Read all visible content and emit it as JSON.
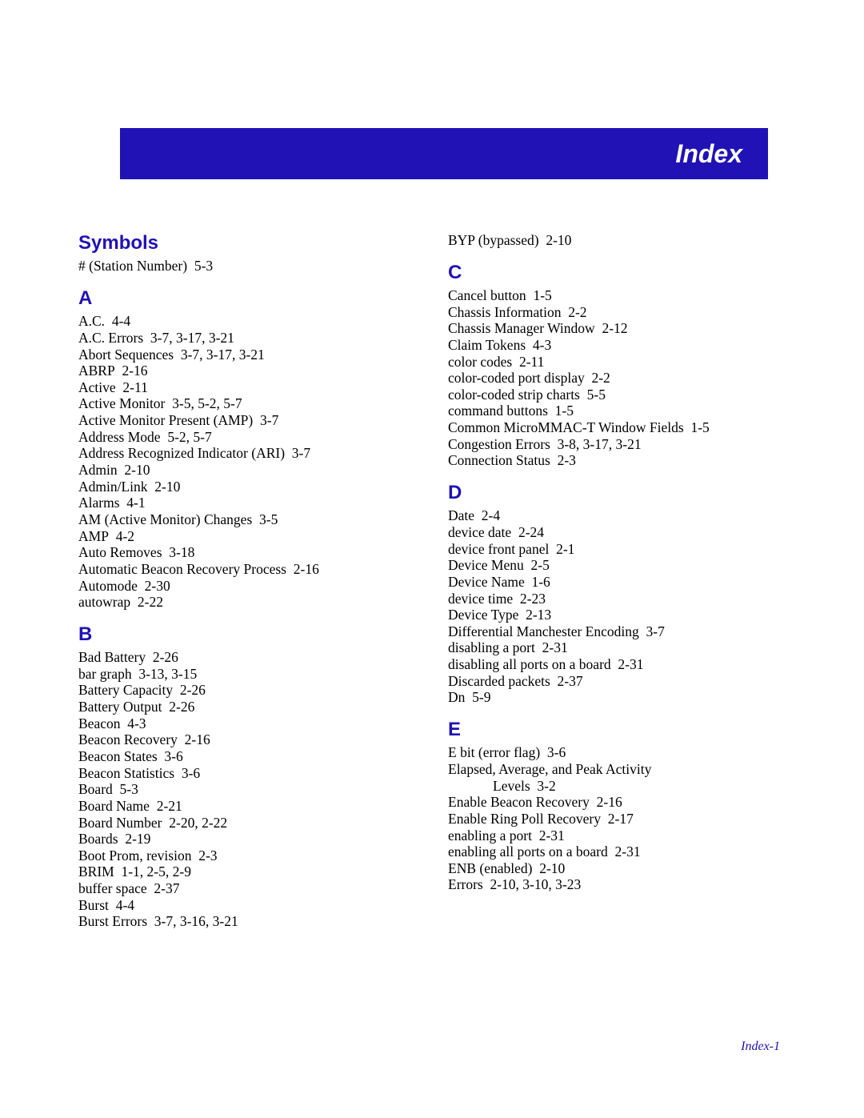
{
  "title": "Index",
  "footer": "Index-1",
  "sections": [
    {
      "col": 0,
      "title": "Symbols",
      "first": true,
      "entries": [
        {
          "t": "# (Station Number)",
          "r": "5-3"
        }
      ]
    },
    {
      "col": 0,
      "title": "A",
      "entries": [
        {
          "t": "A.C.",
          "r": "4-4"
        },
        {
          "t": "A.C. Errors",
          "r": "3-7, 3-17, 3-21"
        },
        {
          "t": "Abort Sequences",
          "r": "3-7, 3-17, 3-21"
        },
        {
          "t": "ABRP",
          "r": "2-16"
        },
        {
          "t": "Active",
          "r": "2-11"
        },
        {
          "t": "Active Monitor",
          "r": "3-5, 5-2, 5-7"
        },
        {
          "t": "Active Monitor Present (AMP)",
          "r": "3-7"
        },
        {
          "t": "Address Mode",
          "r": "5-2, 5-7"
        },
        {
          "t": "Address Recognized Indicator (ARI)",
          "r": "3-7"
        },
        {
          "t": "Admin",
          "r": "2-10"
        },
        {
          "t": "Admin/Link",
          "r": "2-10"
        },
        {
          "t": "Alarms",
          "r": "4-1"
        },
        {
          "t": "AM (Active Monitor) Changes",
          "r": "3-5"
        },
        {
          "t": "AMP",
          "r": "4-2"
        },
        {
          "t": "Auto Removes",
          "r": "3-18"
        },
        {
          "t": "Automatic Beacon Recovery Process",
          "r": "2-16"
        },
        {
          "t": "Automode",
          "r": "2-30"
        },
        {
          "t": "autowrap",
          "r": "2-22"
        }
      ]
    },
    {
      "col": 0,
      "title": "B",
      "entries": [
        {
          "t": "Bad Battery",
          "r": "2-26"
        },
        {
          "t": "bar graph",
          "r": "3-13, 3-15"
        },
        {
          "t": "Battery Capacity",
          "r": "2-26"
        },
        {
          "t": "Battery Output",
          "r": "2-26"
        },
        {
          "t": "Beacon",
          "r": "4-3"
        },
        {
          "t": "Beacon Recovery",
          "r": "2-16"
        },
        {
          "t": "Beacon States",
          "r": "3-6"
        },
        {
          "t": "Beacon Statistics",
          "r": "3-6"
        },
        {
          "t": "Board",
          "r": "5-3"
        },
        {
          "t": "Board Name",
          "r": "2-21"
        },
        {
          "t": "Board Number",
          "r": "2-20, 2-22"
        },
        {
          "t": "Boards",
          "r": "2-19"
        },
        {
          "t": "Boot Prom, revision",
          "r": "2-3"
        },
        {
          "t": "BRIM",
          "r": "1-1, 2-5, 2-9"
        },
        {
          "t": "buffer space",
          "r": "2-37"
        },
        {
          "t": "Burst",
          "r": "4-4"
        },
        {
          "t": "Burst Errors",
          "r": "3-7, 3-16, 3-21"
        }
      ]
    },
    {
      "col": 1,
      "title": "",
      "first": true,
      "entries": [
        {
          "t": "BYP (bypassed)",
          "r": "2-10"
        }
      ]
    },
    {
      "col": 1,
      "title": "C",
      "entries": [
        {
          "t": "Cancel button",
          "r": "1-5"
        },
        {
          "t": "Chassis Information",
          "r": "2-2"
        },
        {
          "t": "Chassis Manager Window",
          "r": "2-12"
        },
        {
          "t": "Claim Tokens",
          "r": "4-3"
        },
        {
          "t": "color codes",
          "r": "2-11"
        },
        {
          "t": "color-coded port display",
          "r": "2-2"
        },
        {
          "t": "color-coded strip charts",
          "r": "5-5"
        },
        {
          "t": "command buttons",
          "r": "1-5"
        },
        {
          "t": "Common MicroMMAC-T Window Fields",
          "r": "1-5"
        },
        {
          "t": "Congestion Errors",
          "r": "3-8, 3-17, 3-21"
        },
        {
          "t": "Connection Status",
          "r": "2-3"
        }
      ]
    },
    {
      "col": 1,
      "title": "D",
      "entries": [
        {
          "t": "Date",
          "r": "2-4"
        },
        {
          "t": "device date",
          "r": "2-24"
        },
        {
          "t": "device front panel",
          "r": "2-1"
        },
        {
          "t": "Device Menu",
          "r": "2-5"
        },
        {
          "t": "Device Name",
          "r": "1-6"
        },
        {
          "t": "device time",
          "r": "2-23"
        },
        {
          "t": "Device Type",
          "r": "2-13"
        },
        {
          "t": "Differential Manchester Encoding",
          "r": "3-7"
        },
        {
          "t": "disabling a port",
          "r": "2-31"
        },
        {
          "t": "disabling all ports on a board",
          "r": "2-31"
        },
        {
          "t": "Discarded packets",
          "r": "2-37"
        },
        {
          "t": "Dn",
          "r": "5-9"
        }
      ]
    },
    {
      "col": 1,
      "title": "E",
      "entries": [
        {
          "t": "E bit (error flag)",
          "r": "3-6"
        },
        {
          "t": "Elapsed, Average, and Peak Activity",
          "r": ""
        },
        {
          "t": "Levels",
          "r": "3-2",
          "lvl": 2
        },
        {
          "t": "Enable Beacon Recovery",
          "r": "2-16"
        },
        {
          "t": "Enable Ring Poll Recovery",
          "r": "2-17"
        },
        {
          "t": "enabling a port",
          "r": "2-31"
        },
        {
          "t": "enabling all ports on a board",
          "r": "2-31"
        },
        {
          "t": "ENB (enabled)",
          "r": "2-10"
        },
        {
          "t": "Errors",
          "r": "2-10, 3-10, 3-23"
        }
      ]
    }
  ]
}
